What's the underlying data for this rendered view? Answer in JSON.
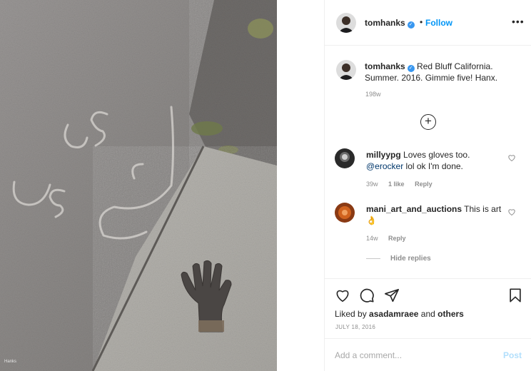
{
  "photo": {
    "subject": "work glove on concrete curb",
    "chalk_text": "U S P S",
    "watermark": "Hanks"
  },
  "header": {
    "username": "tomhanks",
    "separator": "•",
    "follow_label": "Follow",
    "more_icon": "more-horizontal-icon",
    "more_label": "•••"
  },
  "caption": {
    "username": "tomhanks",
    "text": "Red Bluff California. Summer. 2016. Gimmie five! Hanx.",
    "time": "198w"
  },
  "load_more_icon": "plus-circle-icon",
  "load_more_label": "+",
  "comments": [
    {
      "username": "millyypg",
      "text": "Loves gloves too.",
      "mention": "@erocker",
      "text2": "lol ok I'm done.",
      "time": "39w",
      "likes": "1 like",
      "reply": "Reply"
    },
    {
      "username": "mani_art_and_auctions",
      "text": "This is art👌",
      "time": "14w",
      "reply": "Reply"
    }
  ],
  "hide_replies": "Hide replies",
  "actions": {
    "like_icon": "heart-icon",
    "comment_icon": "comment-icon",
    "share_icon": "paper-plane-icon",
    "save_icon": "bookmark-icon"
  },
  "likes": {
    "prefix": "Liked by",
    "user": "asadamraee",
    "and": "and",
    "others": "others"
  },
  "date": "JULY 18, 2016",
  "comment_bar": {
    "placeholder": "Add a comment...",
    "post_label": "Post"
  },
  "colors": {
    "link_blue": "#0095f6",
    "verified_blue": "#3897f0",
    "text": "#262626",
    "muted": "#8e8e8e",
    "border": "#efefef"
  }
}
